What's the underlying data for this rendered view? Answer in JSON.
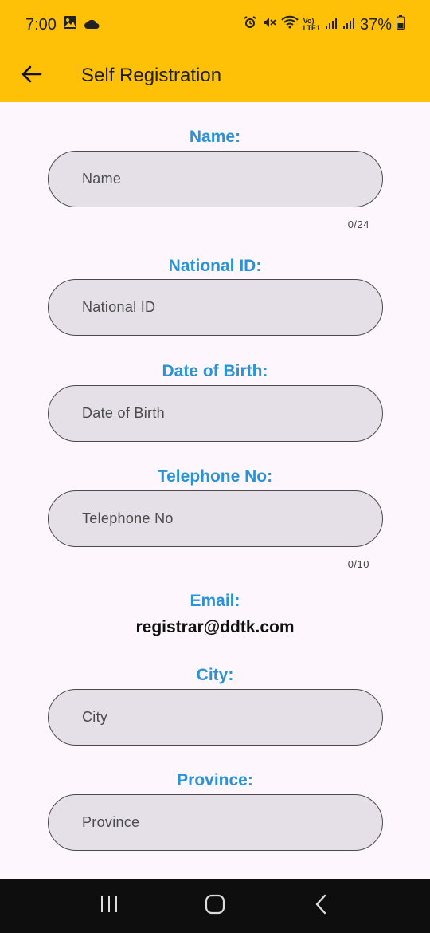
{
  "status_bar": {
    "time": "7:00",
    "battery": "37%",
    "icons": [
      "gallery-icon",
      "cloud-icon",
      "alarm-icon",
      "mute-icon",
      "wifi-icon",
      "volte-icon",
      "signal-icon",
      "signal-icon",
      "battery-icon"
    ]
  },
  "app_bar": {
    "title": "Self Registration",
    "back_icon": "arrow-left-icon"
  },
  "form": {
    "name": {
      "label": "Name:",
      "placeholder": "Name",
      "counter": "0/24"
    },
    "national_id": {
      "label": "National ID:",
      "placeholder": "National ID"
    },
    "dob": {
      "label": "Date of Birth:",
      "placeholder": "Date of Birth"
    },
    "telephone": {
      "label": "Telephone No:",
      "placeholder": "Telephone No",
      "counter": "0/10"
    },
    "email": {
      "label": "Email:",
      "value": "registrar@ddtk.com"
    },
    "city": {
      "label": "City:",
      "placeholder": "City"
    },
    "province": {
      "label": "Province:",
      "placeholder": "Province"
    }
  },
  "nav_bar": {
    "icons": [
      "recent-apps-icon",
      "home-icon",
      "back-icon"
    ]
  },
  "colors": {
    "app_bar": "#ffc107",
    "label": "#2a93d5",
    "field_bg": "#e5e0e8",
    "background": "#fdf7fd"
  }
}
